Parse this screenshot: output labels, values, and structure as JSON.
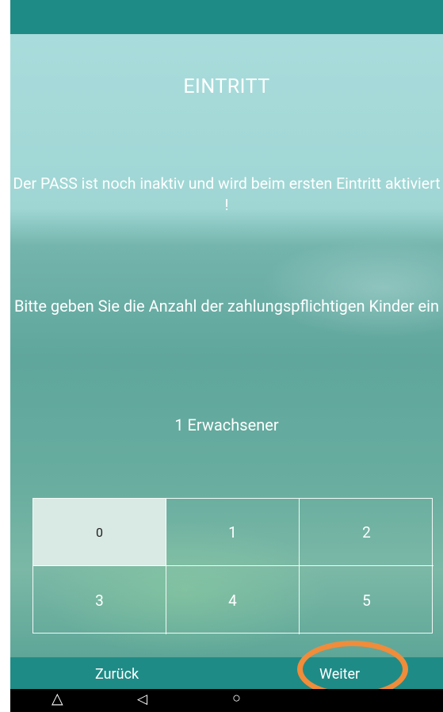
{
  "header": {
    "title": "EINTRITT"
  },
  "message": {
    "inactive_pass": "Der PASS ist noch inaktiv und wird beim ersten Eintritt aktiviert !"
  },
  "prompt": {
    "children_count": "Bitte geben Sie die Anzahl der zahlungspflichtigen Kinder ein"
  },
  "summary": {
    "adults": "1 Erwachsener"
  },
  "keypad": {
    "selected": "0",
    "keys": [
      "0",
      "1",
      "2",
      "3",
      "4",
      "5"
    ]
  },
  "navigation": {
    "back_label": "Zurück",
    "next_label": "Weiter"
  },
  "system_bar": {
    "icons": [
      "up-triangle-icon",
      "back-triangle-icon",
      "home-circle-icon"
    ]
  },
  "colors": {
    "accent": "#1f8b86",
    "highlight_ring": "#f08c3a",
    "selected_key": "#d9e9e4"
  }
}
